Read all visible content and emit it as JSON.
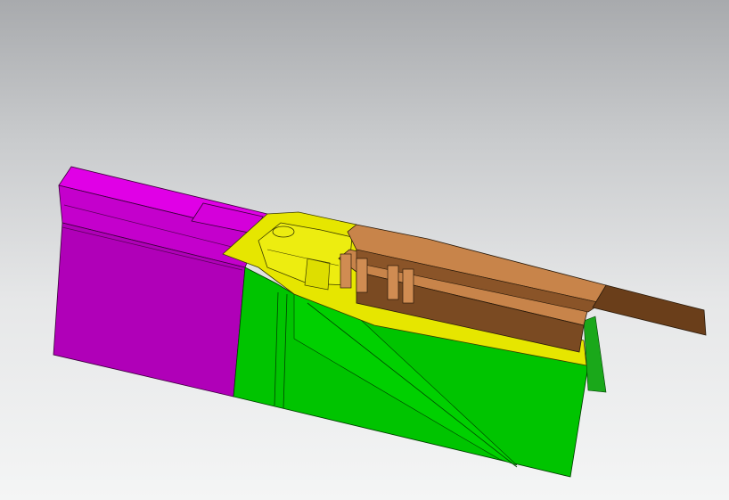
{
  "viewport": {
    "background_top": "#a8aaad",
    "background_bottom": "#f4f5f5"
  },
  "parts": [
    {
      "name": "side-panel-part",
      "color": "#b000b8"
    },
    {
      "name": "support-bracket-part",
      "color": "#00c400"
    },
    {
      "name": "center-housing-part",
      "color": "#e6e600"
    },
    {
      "name": "rail-part",
      "color": "#7a4a22"
    }
  ]
}
